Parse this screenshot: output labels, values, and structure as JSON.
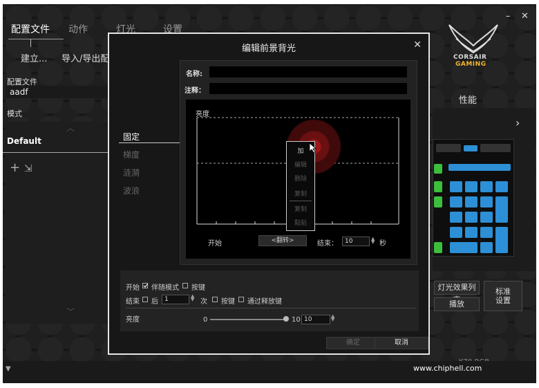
{
  "nav": {
    "tabs": [
      "配置文件",
      "动作",
      "灯光",
      "设置"
    ],
    "sub_create": "建立...",
    "sub_import": "导入/导出配",
    "minimize": "–",
    "close": "✕"
  },
  "left": {
    "profile_label": "配置文件",
    "profile_value": "aadf",
    "mode_label": "模式",
    "mode_default": "Default",
    "icons": [
      "add-icon",
      "import-icon"
    ]
  },
  "right": {
    "logo_line1": "CORSAIR",
    "logo_line2": "GAMING",
    "performance": "性能",
    "light_effects_list": "灯光效果列表",
    "play": "播放",
    "standard_line1": "标准",
    "standard_line2": "设置",
    "device": "K70 RGB",
    "watermark": "www.chiphell.com"
  },
  "modal": {
    "title": "编辑前景背光",
    "close": "✕",
    "effects": [
      "固定",
      "梯度",
      "涟漪",
      "波浪"
    ],
    "active_effect": "固定",
    "name_label": "名称:",
    "note_label": "注释：",
    "graph_label": "亮度",
    "context_menu": [
      "加",
      "编辑",
      "删除",
      "复制",
      "复制",
      "黏贴"
    ],
    "start_label": "开始",
    "flip_button": "<翻转>",
    "end_label": "结束：",
    "end_value": "10",
    "seconds": "秒",
    "options": {
      "start": "开始",
      "follow_mode": "伴随模式",
      "keypress1": "按键",
      "end": "结束",
      "after": "后",
      "count_value": "1",
      "times": "次",
      "keypress2": "按键",
      "release_key": "通过释放键",
      "brightness": "亮度",
      "slider_min": "0",
      "slider_max": "10",
      "slider_value": "10"
    },
    "ok": "确定",
    "cancel": "取消"
  },
  "colors": {
    "accent_blue": "#2d8fd6",
    "key_green": "#3cbf3c",
    "logo_gold": "#f3b530"
  }
}
